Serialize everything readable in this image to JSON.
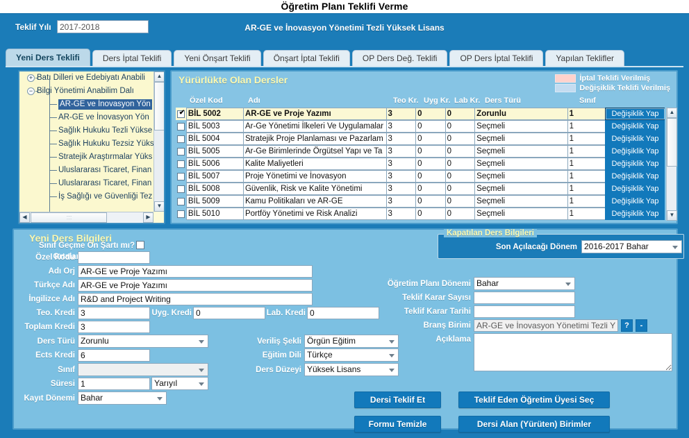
{
  "page": {
    "title": "Öğretim Planı Teklifi Verme",
    "program": "AR-GE ve İnovasyon Yönetimi Tezli Yüksek Lisans"
  },
  "topstrip": {
    "teklif_yili_label": "Teklif Yılı",
    "teklif_yili_value": "2017-2018"
  },
  "tabs": [
    {
      "label": "Yeni Ders Teklifi",
      "active": true
    },
    {
      "label": "Ders İptal Teklifi",
      "active": false
    },
    {
      "label": "Yeni Önşart Teklifi",
      "active": false
    },
    {
      "label": "Önşart İptal Teklifi",
      "active": false
    },
    {
      "label": "OP Ders Değ. Teklifi",
      "active": false
    },
    {
      "label": "OP Ders İptal Teklifi",
      "active": false
    },
    {
      "label": "Yapılan Teklifler",
      "active": false
    }
  ],
  "tree": {
    "nodes": [
      {
        "label": "Batı Dilleri ve Edebiyatı Anabili",
        "level": 1,
        "expander": "+",
        "selected": false
      },
      {
        "label": "Bilgi Yönetimi Anabilim Dalı",
        "level": 1,
        "expander": "−",
        "selected": false
      },
      {
        "label": "AR-GE ve İnovasyon Yön",
        "level": 2,
        "expander": "",
        "selected": true
      },
      {
        "label": "AR-GE ve İnovasyon Yön",
        "level": 2,
        "expander": "",
        "selected": false
      },
      {
        "label": "Sağlık Hukuku Tezli Yükse",
        "level": 2,
        "expander": "",
        "selected": false
      },
      {
        "label": "Sağlık Hukuku Tezsiz Yüks",
        "level": 2,
        "expander": "",
        "selected": false
      },
      {
        "label": "Stratejik Araştırmalar Yüks",
        "level": 2,
        "expander": "",
        "selected": false
      },
      {
        "label": "Uluslararası Ticaret, Finan",
        "level": 2,
        "expander": "",
        "selected": false
      },
      {
        "label": "Uluslararası Ticaret, Finan",
        "level": 2,
        "expander": "",
        "selected": false
      },
      {
        "label": "İş Sağlığı ve Güvenliği Tez",
        "level": 2,
        "expander": "",
        "selected": false
      }
    ]
  },
  "grid": {
    "title": "Yürürlükte Olan Dersler",
    "legend": [
      {
        "color": "#ffd2cc",
        "label": "İptal Teklifi Verilmiş"
      },
      {
        "color": "#c4dcf0",
        "label": "Değişiklik Teklifi Verilmiş"
      }
    ],
    "columns": [
      "Özel Kod",
      "Adı",
      "Teo Kr.",
      "Uyg Kr.",
      "Lab Kr.",
      "Ders Türü",
      "Sınıf"
    ],
    "action_label": "Değişiklik Yap",
    "rows": [
      {
        "checked": true,
        "kod": "BİL 5002",
        "ad": "AR-GE ve Proje Yazımı",
        "teo": "3",
        "uyg": "0",
        "lab": "0",
        "tur": "Zorunlu",
        "sinif": "1"
      },
      {
        "checked": false,
        "kod": "BİL 5003",
        "ad": "Ar-Ge Yönetimi İlkeleri Ve Uygulamalar",
        "teo": "3",
        "uyg": "0",
        "lab": "0",
        "tur": "Seçmeli",
        "sinif": "1"
      },
      {
        "checked": false,
        "kod": "BİL 5004",
        "ad": "Stratejik Proje Planlaması ve Pazarlam",
        "teo": "3",
        "uyg": "0",
        "lab": "0",
        "tur": "Seçmeli",
        "sinif": "1"
      },
      {
        "checked": false,
        "kod": "BİL 5005",
        "ad": "Ar-Ge Birimlerinde Örgütsel Yapı ve Ta",
        "teo": "3",
        "uyg": "0",
        "lab": "0",
        "tur": "Seçmeli",
        "sinif": "1"
      },
      {
        "checked": false,
        "kod": "BİL 5006",
        "ad": "Kalite Maliyetleri",
        "teo": "3",
        "uyg": "0",
        "lab": "0",
        "tur": "Seçmeli",
        "sinif": "1"
      },
      {
        "checked": false,
        "kod": "BİL 5007",
        "ad": "Proje Yönetimi ve İnovasyon",
        "teo": "3",
        "uyg": "0",
        "lab": "0",
        "tur": "Seçmeli",
        "sinif": "1"
      },
      {
        "checked": false,
        "kod": "BİL 5008",
        "ad": "Güvenlik, Risk ve Kalite Yönetimi",
        "teo": "3",
        "uyg": "0",
        "lab": "0",
        "tur": "Seçmeli",
        "sinif": "1"
      },
      {
        "checked": false,
        "kod": "BİL 5009",
        "ad": "Kamu Politikaları ve AR-GE",
        "teo": "3",
        "uyg": "0",
        "lab": "0",
        "tur": "Seçmeli",
        "sinif": "1"
      },
      {
        "checked": false,
        "kod": "BİL 5010",
        "ad": "Portföy Yönetimi ve Risk Analizi",
        "teo": "3",
        "uyg": "0",
        "lab": "0",
        "tur": "Seçmeli",
        "sinif": "1"
      }
    ]
  },
  "form": {
    "title": "Yeni Ders Bilgileri",
    "ozel_kodu_label": "Özel Kodu",
    "ozel_kodu_value": "",
    "adi_orj_label": "Adı Orj",
    "adi_orj_value": "AR-GE ve Proje Yazımı",
    "turkce_adi_label": "Türkçe Adı",
    "turkce_adi_value": "AR-GE ve Proje Yazımı",
    "ingilizce_adi_label": "İngilizce Adı",
    "ingilizce_adi_value": "R&D and Project Writing",
    "teo_kredi_label": "Teo. Kredi",
    "teo_kredi_value": "3",
    "uyg_kredi_label": "Uyg. Kredi",
    "uyg_kredi_value": "0",
    "lab_kredi_label": "Lab. Kredi",
    "lab_kredi_value": "0",
    "toplam_kredi_label": "Toplam Kredi",
    "toplam_kredi_value": "3",
    "ders_turu_label": "Ders Türü",
    "ders_turu_value": "Zorunlu",
    "ects_kredi_label": "Ects Kredi",
    "ects_kredi_value": "6",
    "sinif_label": "Sınıf",
    "sinif_value": "",
    "suresi_label": "Süresi",
    "suresi_value": "1",
    "suresi_unit_value": "Yarıyıl",
    "kayit_donemi_label": "Kayıt Dönemi",
    "kayit_donemi_value": "Bahar",
    "verilis_sekli_label": "Veriliş Şekli",
    "verilis_sekli_value": "Örgün Eğitim",
    "egitim_dili_label": "Eğitim Dili",
    "egitim_dili_value": "Türkçe",
    "ders_duzeyi_label": "Ders Düzeyi",
    "ders_duzeyi_value": "Yüksek Lisans",
    "sinif_gecme_label": "Sınıf Geçme Ön Şartı mı?",
    "sinif_gecme_checked": false,
    "ortalamaya_dahil_label": "Ortalamaya Dahil mi?",
    "ortalamaya_dahil_checked": true,
    "kapatilan_legend": "Kapatılan Ders Bilgileri",
    "son_acilacagi_label": "Son Açılacağı Dönem",
    "son_acilacagi_value": "2016-2017 Bahar",
    "op_donemi_label": "Öğretim Planı Dönemi",
    "op_donemi_value": "Bahar",
    "teklif_karar_sayisi_label": "Teklif Karar Sayısı",
    "teklif_karar_sayisi_value": "",
    "teklif_karar_tarihi_label": "Teklif Karar Tarihi",
    "teklif_karar_tarihi_value": "",
    "brans_birimi_label": "Branş Birimi",
    "brans_birimi_value": "AR-GE ve İnovasyon Yönetimi Tezli Yü",
    "brans_help_btn": "?",
    "brans_clear_btn": "-",
    "aciklama_label": "Açıklama",
    "aciklama_value": ""
  },
  "buttons": {
    "dersi_teklif_et": "Dersi Teklif Et",
    "formu_temizle": "Formu Temizle",
    "teklif_eden": "Teklif Eden Öğretim Üyesi Seç",
    "dersi_alan": "Dersi Alan (Yürüten) Birimler"
  },
  "icons": {
    "arrow_up": "▲",
    "arrow_down": "▼",
    "arrow_left": "◀",
    "arrow_right": "▶"
  }
}
